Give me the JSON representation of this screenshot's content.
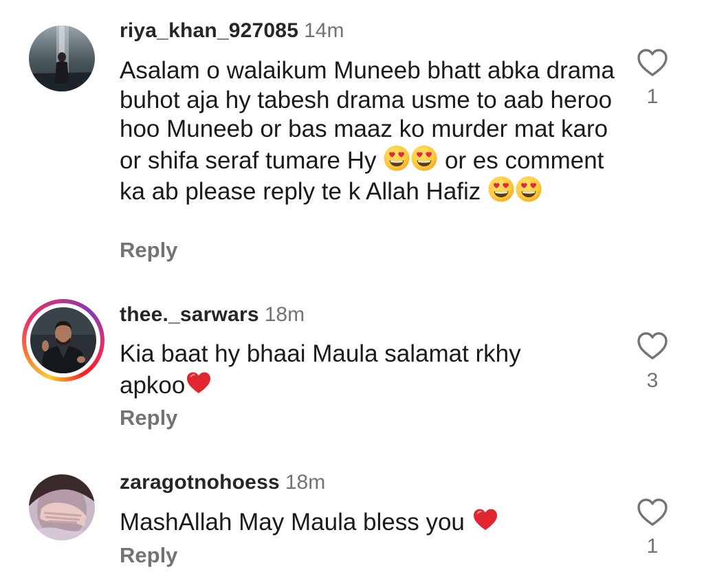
{
  "comments": [
    {
      "username": "riya_khan_927085",
      "time": "14m",
      "text_parts": [
        "Asalam o walaikum Muneeb bhatt abka drama buhot aja hy tabesh drama usme to aab heroo hoo Muneeb or bas maaz ko murder mat karo or shifa seraf tumare Hy",
        "or es comment ka ab please reply te k Allah Hafiz"
      ],
      "emoji": [
        "heart-eyes",
        "heart-eyes",
        "heart-eyes",
        "heart-eyes"
      ],
      "reply_label": "Reply",
      "like_count": "1"
    },
    {
      "username": "thee._sarwars",
      "time": "18m",
      "text_parts": [
        "Kia baat hy bhaai Maula salamat rkhy apkoo"
      ],
      "emoji": [
        "red-heart"
      ],
      "reply_label": "Reply",
      "like_count": "3",
      "has_story_ring": true
    },
    {
      "username": "zaragotnohoess",
      "time": "18m",
      "text_parts": [
        "MashAllah May Maula bless you"
      ],
      "emoji": [
        "red-heart"
      ],
      "reply_label": "Reply",
      "like_count": "1"
    }
  ],
  "icons": {
    "like": "heart-outline-icon"
  },
  "colors": {
    "username": "#262626",
    "secondary": "#737373",
    "text": "#1a1a1a",
    "heart_emoji": "#e0262f",
    "story_ring": [
      "#fdc82f",
      "#f77737",
      "#e1306c",
      "#c13584",
      "#833ab4"
    ]
  }
}
